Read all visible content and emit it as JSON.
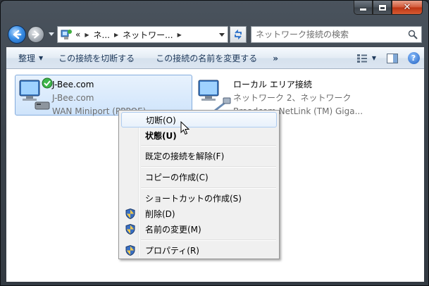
{
  "nav": {
    "breadcrumb": [
      "«",
      "ネ...",
      "ネットワー..."
    ],
    "search_placeholder": "ネットワーク接続の検索"
  },
  "toolbar": {
    "organize": "整理",
    "disconnect": "この接続を切断する",
    "rename": "この接続の名前を変更する",
    "more": "»"
  },
  "items": [
    {
      "name": "J-Bee.com",
      "line2": "J-Bee.com",
      "line3": "WAN Miniport (PPPOE)"
    },
    {
      "name": "ローカル エリア接続",
      "line2": "ネットワーク 2、ネットワーク",
      "line3": "Broadcom NetLink (TM) Giga..."
    }
  ],
  "context_menu": {
    "items": [
      {
        "label": "切断(O)",
        "shield": false
      },
      {
        "label": "状態(U)",
        "shield": false
      },
      {
        "label": "既定の接続を解除(F)",
        "shield": false
      },
      {
        "label": "コピーの作成(C)",
        "shield": false
      },
      {
        "label": "ショートカットの作成(S)",
        "shield": false
      },
      {
        "label": "削除(D)",
        "shield": true
      },
      {
        "label": "名前の変更(M)",
        "shield": true
      },
      {
        "label": "プロパティ(R)",
        "shield": true
      }
    ]
  },
  "colors": {
    "accent": "#1e395b",
    "selection": "#cfe4fb",
    "close_button": "#c7401b"
  }
}
